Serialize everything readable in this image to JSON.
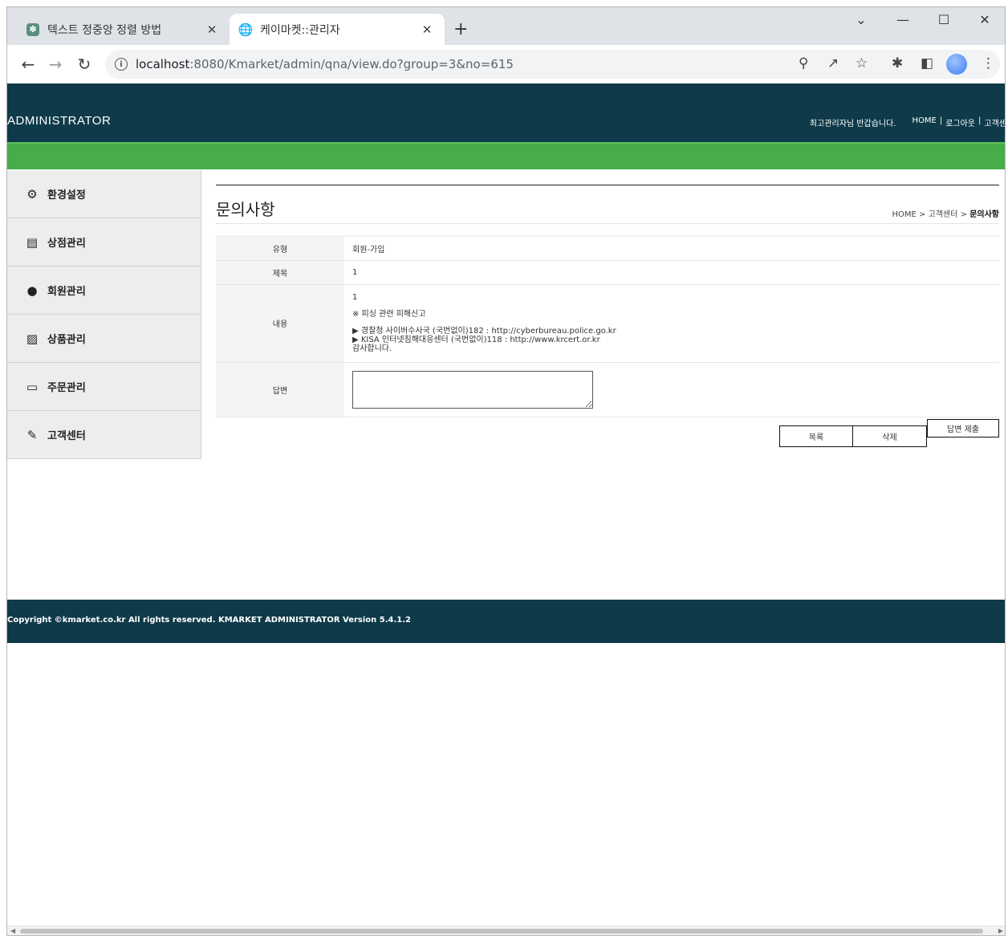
{
  "browser": {
    "tabs": [
      {
        "title": "텍스트 정중앙 정렬 방법",
        "icon": "chatgpt-icon",
        "active": false
      },
      {
        "title": "케이마켓::관리자",
        "icon": "globe-icon",
        "active": true
      }
    ],
    "url": {
      "host": "localhost",
      "rest": ":8080/Kmarket/admin/qna/view.do?group=3&no=615"
    }
  },
  "header": {
    "logo": "ADMINISTRATOR",
    "greeting": "최고관리자님 반갑습니다.",
    "links": [
      "HOME",
      "|",
      "로그아웃",
      "|",
      "고객센"
    ]
  },
  "sidebar": {
    "items": [
      {
        "label": "환경설정",
        "icon": "gears-icon"
      },
      {
        "label": "상점관리",
        "icon": "store-icon"
      },
      {
        "label": "회원관리",
        "icon": "users-icon"
      },
      {
        "label": "상품관리",
        "icon": "boxes-icon"
      },
      {
        "label": "주문관리",
        "icon": "card-icon"
      },
      {
        "label": "고객센터",
        "icon": "edit-icon"
      }
    ]
  },
  "main": {
    "title": "문의사항",
    "breadcrumb": {
      "home": "HOME",
      "sep": ">",
      "section": "고객센터",
      "current": "문의사항"
    },
    "fields": {
      "type_label": "유형",
      "type_value": "회원-가입",
      "subject_label": "제목",
      "subject_value": "1",
      "content_label": "내용",
      "content_lines": [
        "1",
        "",
        "※ 피싱 관련 피해신고",
        "",
        "▶ 경찰청 사이버수사국 (국번없이)182 : http://cyberbureau.police.go.kr",
        "▶ KISA 인터넷침해대응센터 (국번없이)118 : http://www.krcert.or.kr",
        "감사합니다."
      ],
      "answer_label": "답변",
      "answer_value": ""
    },
    "buttons": {
      "list": "목록",
      "delete": "삭제",
      "submit": "답변 제출"
    }
  },
  "footer": {
    "copyright": "Copyright ©kmarket.co.kr All rights reserved.  KMARKET ADMINISTRATOR Version 5.4.1.2"
  }
}
